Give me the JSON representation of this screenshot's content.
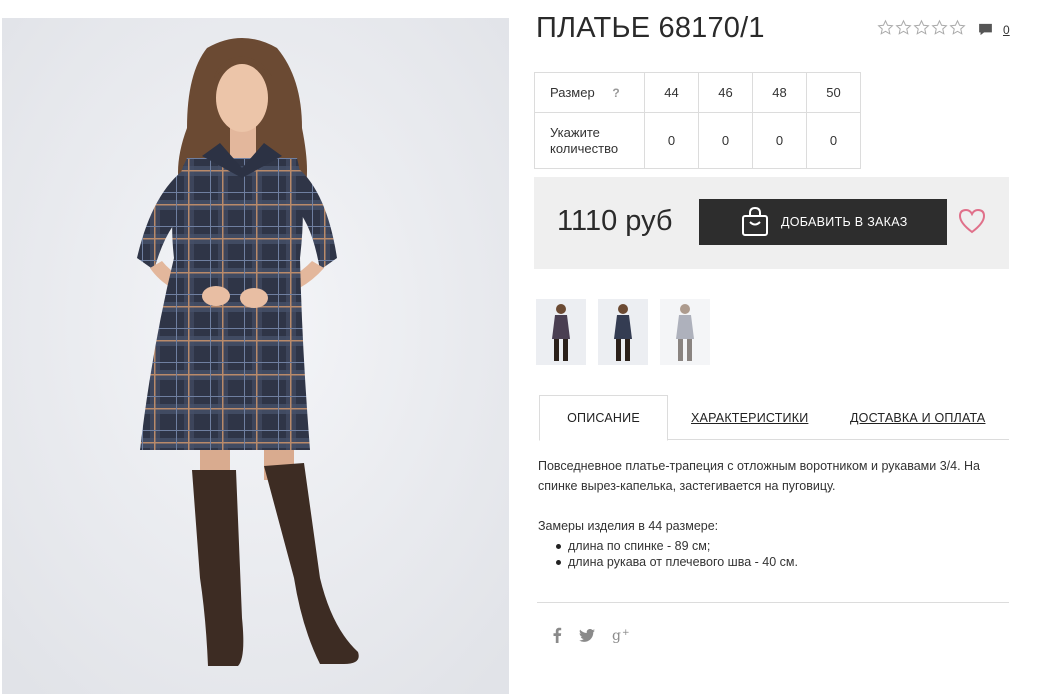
{
  "product": {
    "title": "ПЛАТЬЕ 68170/1",
    "rating": 0,
    "rating_max": 5,
    "comments_count": "0",
    "price": "1110 руб"
  },
  "size_table": {
    "size_label": "Размер",
    "help_mark": "?",
    "sizes": [
      "44",
      "46",
      "48",
      "50"
    ],
    "qty_label": "Укажите количество",
    "quantities": [
      "0",
      "0",
      "0",
      "0"
    ]
  },
  "buy": {
    "add_label": "ДОБАВИТЬ В ЗАКАЗ"
  },
  "thumbnails": [
    "thumbnail-1",
    "thumbnail-2",
    "thumbnail-3"
  ],
  "tabs": [
    {
      "label": "ОПИСАНИЕ"
    },
    {
      "label": "ХАРАКТЕРИСТИКИ"
    },
    {
      "label": "ДОСТАВКА И ОПЛАТА"
    }
  ],
  "description": {
    "paragraph": "Повседневное платье-трапеция с отложным воротником и рукавами 3/4. На спинке вырез-капелька, застегивается на пуговицу.",
    "measures_title": "Замеры изделия в 44 размере:",
    "measures": [
      "длина по спинке - 89 см;",
      "длина рукава от плечевого шва - 40 см."
    ]
  },
  "social": [
    {
      "name": "facebook-icon",
      "glyph": "f"
    },
    {
      "name": "twitter-icon",
      "glyph": "t"
    },
    {
      "name": "google-plus-icon",
      "glyph": "g+"
    }
  ],
  "colors": {
    "button_bg": "#2d2d2d",
    "heart": "#e0708a",
    "panel_bg": "#efefef",
    "dress_plaid": "#3a4255"
  }
}
